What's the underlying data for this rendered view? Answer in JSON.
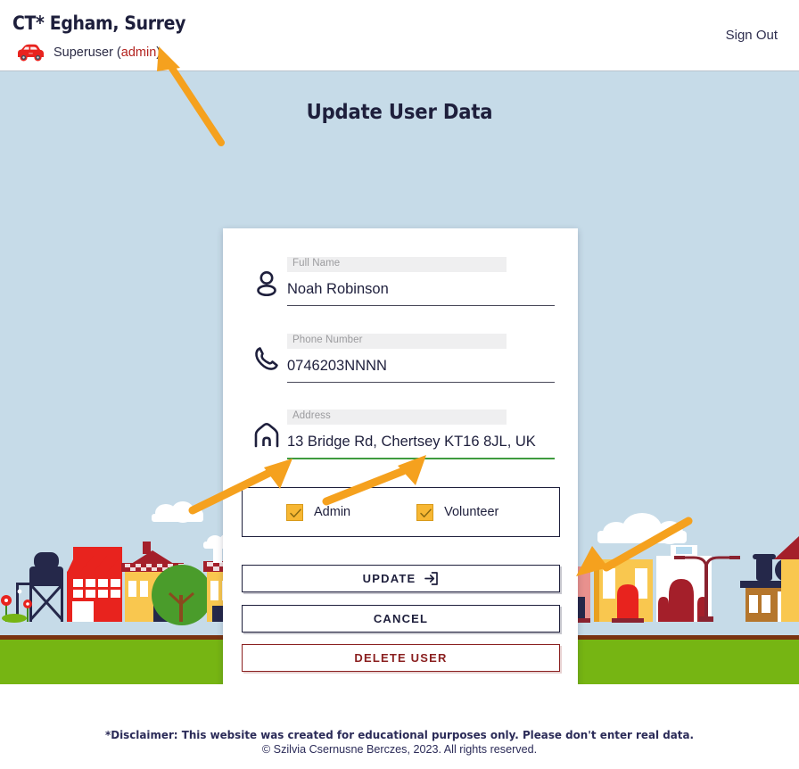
{
  "header": {
    "brand_title": "CT* Egham, Surrey",
    "user_prefix": "Superuser (",
    "user_role": "admin",
    "user_suffix": ")",
    "car_icon": "red-car-icon",
    "sign_out_label": "Sign Out"
  },
  "page": {
    "title": "Update User Data",
    "sky_color": "#c6dbe8",
    "grass_color": "#76b513"
  },
  "form": {
    "fields": [
      {
        "label": "Full Name",
        "value": "Noah Robinson",
        "icon": "person-icon",
        "state": "default"
      },
      {
        "label": "Phone Number",
        "value": "0746203NNNN",
        "icon": "phone-icon",
        "state": "default"
      },
      {
        "label": "Address",
        "value": "13 Bridge Rd, Chertsey KT16 8JL, UK",
        "icon": "home-icon",
        "state": "valid"
      }
    ],
    "roles": [
      {
        "label": "Admin",
        "checked": true
      },
      {
        "label": "Volunteer",
        "checked": true
      }
    ],
    "buttons": [
      {
        "label": "UPDATE",
        "icon": "login-arrow-icon",
        "style": "primary"
      },
      {
        "label": "CANCEL",
        "icon": "",
        "style": "primary"
      },
      {
        "label": "DELETE USER",
        "icon": "",
        "style": "danger"
      }
    ]
  },
  "colors": {
    "ink": "#1e1f3c",
    "danger": "#8a1f1f",
    "valid_green": "#3f9b3f",
    "checkbox_amber": "#f7b733",
    "annotation_orange": "#f5a11e"
  },
  "footer": {
    "disclaimer": "*Disclaimer: This website was created for educational purposes only. Please don't enter real data.",
    "copyright": "© Szilvia Csernusne Berczes, 2023. All rights reserved."
  }
}
